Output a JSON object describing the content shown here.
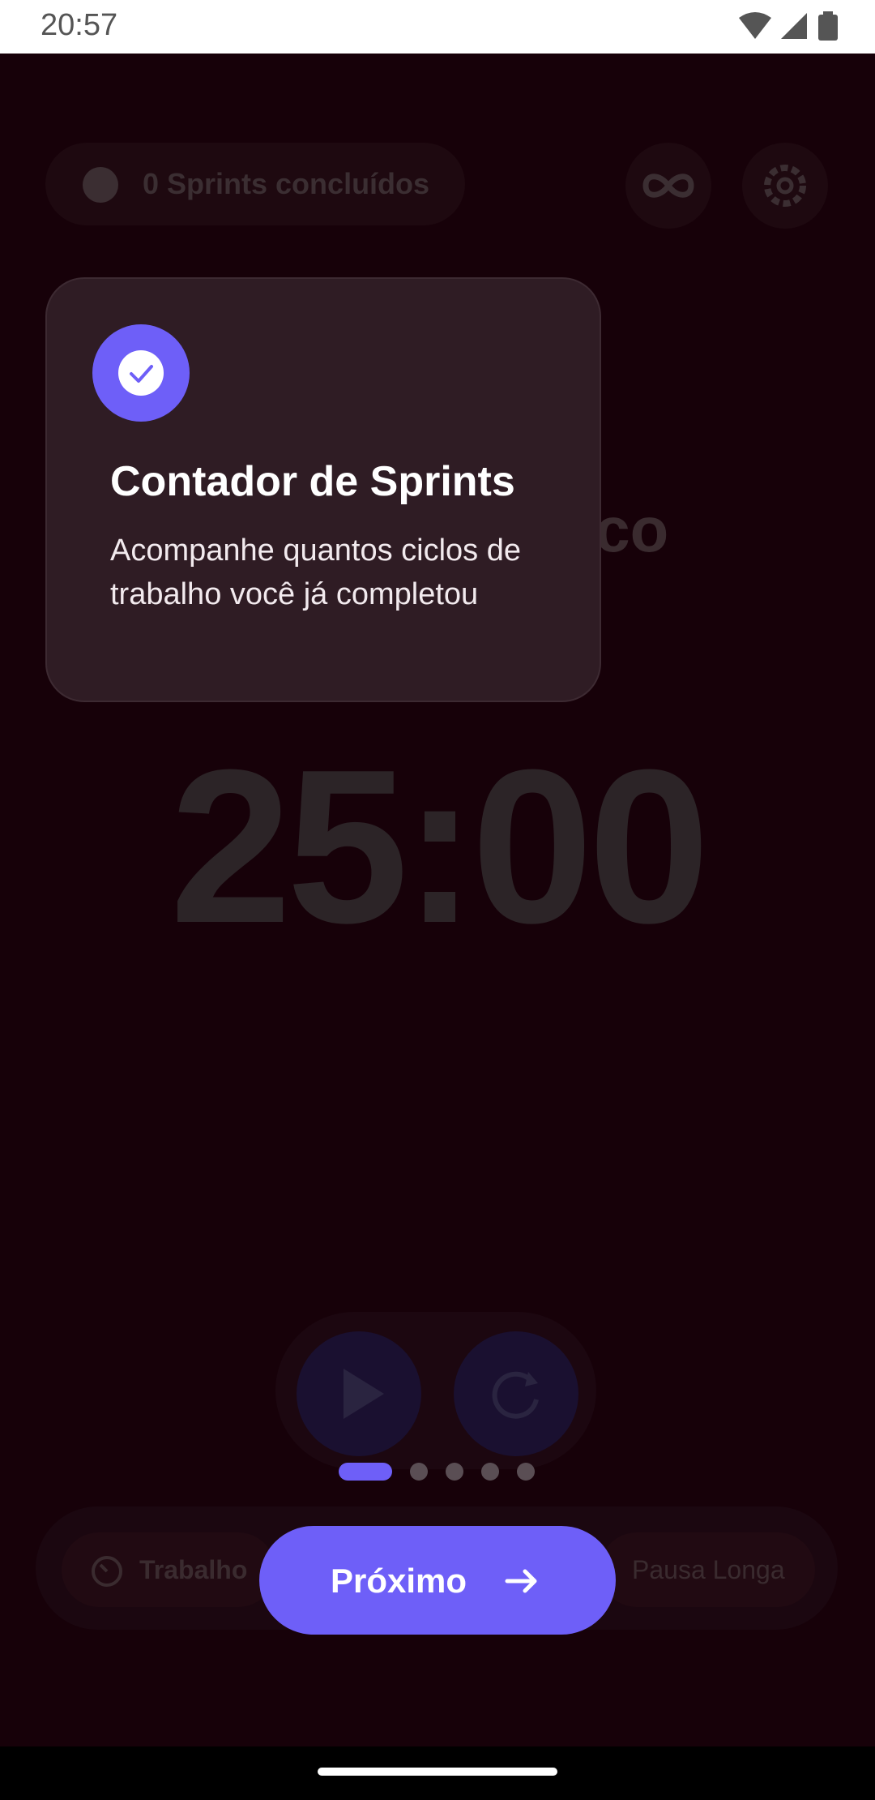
{
  "status_bar": {
    "time": "20:57"
  },
  "header": {
    "sprint_counter": "0 Sprints concluídos",
    "icons": [
      "check-circle-icon",
      "infinity-icon",
      "gear-icon"
    ]
  },
  "timer": {
    "mode_title": "Tempo de Foco",
    "time": "25:00"
  },
  "modes": {
    "work": "Trabalho",
    "long_break": "Pausa Longa"
  },
  "tooltip": {
    "title": "Contador de Sprints",
    "description": "Acompanhe quantos ciclos de trabalho você já completou",
    "icon": "check-icon"
  },
  "onboarding": {
    "total_steps": 5,
    "current_step": 1,
    "next_label": "Próximo"
  },
  "colors": {
    "accent": "#6e5ff8",
    "background": "#170109",
    "card": "#2f1c24"
  }
}
